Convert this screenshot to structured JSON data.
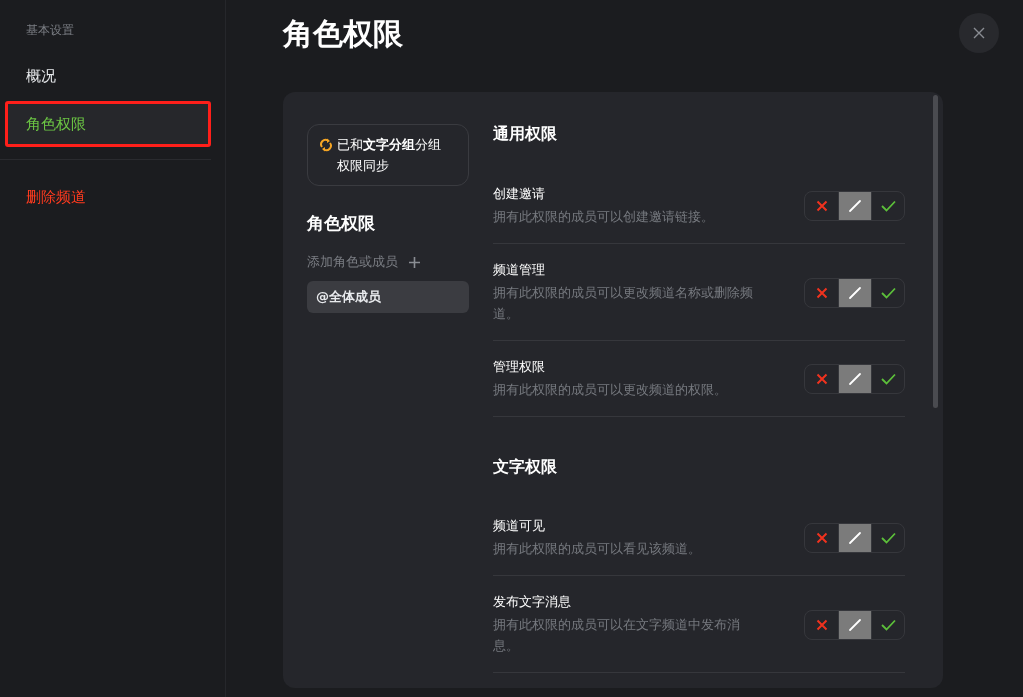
{
  "sidebar": {
    "group_label": "基本设置",
    "items": [
      {
        "label": "概况",
        "selected": false,
        "kind": "nav",
        "highlighted": false
      },
      {
        "label": "角色权限",
        "selected": true,
        "kind": "nav",
        "highlighted": true
      },
      {
        "label": "删除频道",
        "selected": false,
        "kind": "danger",
        "highlighted": false
      }
    ]
  },
  "page_title": "角色权限",
  "sync_notice": "已和**文字分组**分组权限同步",
  "roles": {
    "title": "角色权限",
    "add_label": "添加角色或成员",
    "items": [
      {
        "label": "@全体成员",
        "selected": true
      }
    ]
  },
  "sections": [
    {
      "title": "通用权限",
      "permissions": [
        {
          "name": "创建邀请",
          "description": "拥有此权限的成员可以创建邀请链接。",
          "options": [
            {
              "kind": "deny",
              "selected": false
            },
            {
              "kind": "inherit",
              "selected": true
            },
            {
              "kind": "allow",
              "selected": false
            }
          ]
        },
        {
          "name": "频道管理",
          "description": "拥有此权限的成员可以更改频道名称或删除频道。",
          "options": [
            {
              "kind": "deny",
              "selected": false
            },
            {
              "kind": "inherit",
              "selected": true
            },
            {
              "kind": "allow",
              "selected": false
            }
          ]
        },
        {
          "name": "管理权限",
          "description": "拥有此权限的成员可以更改频道的权限。",
          "options": [
            {
              "kind": "deny",
              "selected": false
            },
            {
              "kind": "inherit",
              "selected": true
            },
            {
              "kind": "allow",
              "selected": false
            }
          ]
        }
      ]
    },
    {
      "title": "文字权限",
      "permissions": [
        {
          "name": "频道可见",
          "description": "拥有此权限的成员可以看见该频道。",
          "options": [
            {
              "kind": "deny",
              "selected": false
            },
            {
              "kind": "inherit",
              "selected": true
            },
            {
              "kind": "allow",
              "selected": false
            }
          ]
        },
        {
          "name": "发布文字消息",
          "description": "拥有此权限的成员可以在文字频道中发布消息。",
          "options": [
            {
              "kind": "deny",
              "selected": false
            },
            {
              "kind": "inherit",
              "selected": true
            },
            {
              "kind": "allow",
              "selected": false
            }
          ]
        }
      ]
    }
  ]
}
